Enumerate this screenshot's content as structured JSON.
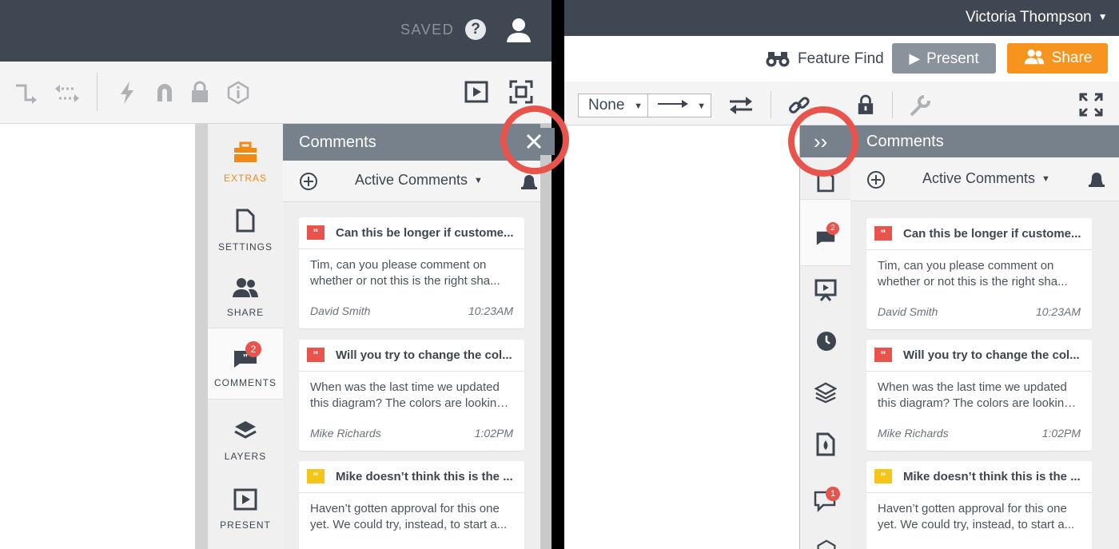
{
  "left": {
    "saved_label": "SAVED",
    "nav": [
      {
        "label": "EXTRAS"
      },
      {
        "label": "SETTINGS"
      },
      {
        "label": "SHARE"
      },
      {
        "label": "COMMENTS",
        "badge": "2"
      },
      {
        "label": "LAYERS"
      },
      {
        "label": "PRESENT"
      }
    ],
    "panel_title": "Comments",
    "filter_label": "Active Comments"
  },
  "right": {
    "user_name": "Victoria Thompson",
    "feature_find": "Feature Find",
    "present_label": "Present",
    "share_label": "Share",
    "line_start": "None",
    "panel_title": "Comments",
    "filter_label": "Active Comments",
    "comments_badge": "2",
    "chat_badge": "1",
    "collapse_glyph": "››"
  },
  "comments": [
    {
      "title": "Can this be longer if custome...",
      "line1": "Tim, can you please comment on",
      "line2": "whether or not this is the right sha...",
      "author": "David Smith",
      "time": "10:23AM",
      "color": "#e8534b"
    },
    {
      "title": "Will you try to change the col...",
      "line1": "When was the last time we updated",
      "line2": "this diagram? The colors are looking ...",
      "author": "Mike Richards",
      "time": "1:02PM",
      "color": "#e8534b"
    },
    {
      "title": "Mike doesn’t think this is the ...",
      "line1": "Haven’t gotten approval for this one",
      "line2": "yet. We could try, instead, to start a...",
      "author": "",
      "time": "",
      "color": "#f5c518"
    }
  ],
  "colors": {
    "dark": "#3f4852",
    "accent_orange": "#f08a13",
    "alert_red": "#e8534b",
    "panel_header": "#77818b"
  }
}
